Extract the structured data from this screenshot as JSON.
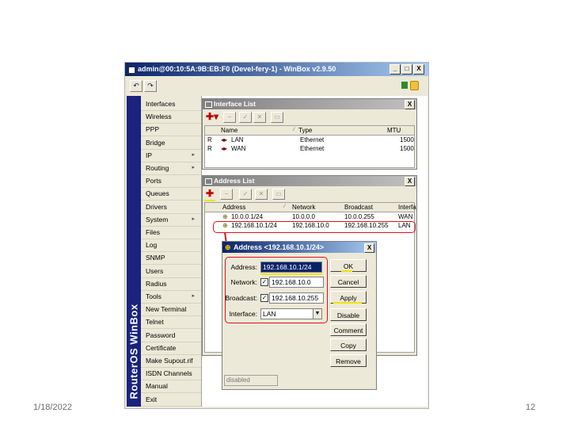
{
  "slide": {
    "date": "1/18/2022",
    "page_number": "12"
  },
  "app": {
    "title": "admin@00:10:5A:9B:EB:F0 (Devel-fery-1) - WinBox v2.9.50",
    "brand_text": "RouterOS WinBox",
    "window_buttons": [
      "_",
      "□",
      "X"
    ],
    "toolbar_icons": [
      "undo-icon",
      "redo-icon"
    ]
  },
  "menu": {
    "items": [
      {
        "label": "Interfaces",
        "submenu": false
      },
      {
        "label": "Wireless",
        "submenu": false
      },
      {
        "label": "PPP",
        "submenu": false
      },
      {
        "label": "Bridge",
        "submenu": false
      },
      {
        "label": "IP",
        "submenu": true
      },
      {
        "label": "Routing",
        "submenu": true
      },
      {
        "label": "Ports",
        "submenu": false
      },
      {
        "label": "Queues",
        "submenu": false
      },
      {
        "label": "Drivers",
        "submenu": false
      },
      {
        "label": "System",
        "submenu": true
      },
      {
        "label": "Files",
        "submenu": false
      },
      {
        "label": "Log",
        "submenu": false
      },
      {
        "label": "SNMP",
        "submenu": false
      },
      {
        "label": "Users",
        "submenu": false
      },
      {
        "label": "Radius",
        "submenu": false
      },
      {
        "label": "Tools",
        "submenu": true
      },
      {
        "label": "New Terminal",
        "submenu": false
      },
      {
        "label": "Telnet",
        "submenu": false
      },
      {
        "label": "Password",
        "submenu": false
      },
      {
        "label": "Certificate",
        "submenu": false
      },
      {
        "label": "Make Supout.rif",
        "submenu": false
      },
      {
        "label": "ISDN Channels",
        "submenu": false
      },
      {
        "label": "Manual",
        "submenu": false
      },
      {
        "label": "Exit",
        "submenu": false
      }
    ],
    "submenu_marker": "▸"
  },
  "interface_list": {
    "title": "Interface List",
    "close": "X",
    "columns": [
      "Name",
      "Type",
      "MTU"
    ],
    "rows": [
      {
        "flag": "R",
        "name": "LAN",
        "type": "Ethernet",
        "mtu": "1500"
      },
      {
        "flag": "R",
        "name": "WAN",
        "type": "Ethernet",
        "mtu": "1500"
      }
    ]
  },
  "address_list": {
    "title": "Address List",
    "close": "X",
    "columns": [
      "Address",
      "Network",
      "Broadcast",
      "Interfa"
    ],
    "rows": [
      {
        "address": "10.0.0.1/24",
        "network": "10.0.0.0",
        "broadcast": "10.0.0.255",
        "interface": "WAN"
      },
      {
        "address": "192.168.10.1/24",
        "network": "192.168.10.0",
        "broadcast": "192.168.10.255",
        "interface": "LAN"
      }
    ]
  },
  "address_dialog": {
    "title": "Address <192.168.10.1/24>",
    "close": "X",
    "address_label": "Address:",
    "address_value": "192.168.10.1/24",
    "network_label": "Network:",
    "network_value": "192.168.10.0",
    "network_checked": "✓",
    "broadcast_label": "Broadcast:",
    "broadcast_value": "192.168.10.255",
    "broadcast_checked": "✓",
    "interface_label": "Interface:",
    "interface_value": "LAN",
    "buttons": {
      "ok": "OK",
      "cancel": "Cancel",
      "apply": "Apply",
      "disable": "Disable",
      "comment": "Comment",
      "copy": "Copy",
      "remove": "Remove"
    },
    "status": "disabled"
  },
  "colors": {
    "brand": "#1a237e",
    "title_active": "#0a246a",
    "highlight_red": "#e0101a",
    "underline_yellow": "#f5e20a"
  }
}
